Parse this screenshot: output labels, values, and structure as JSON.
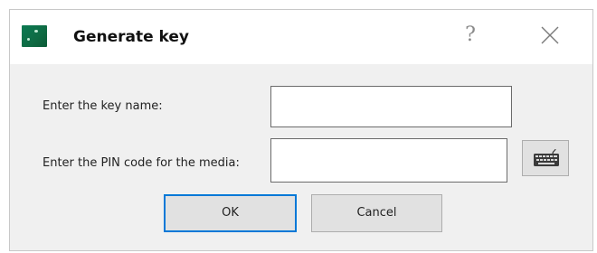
{
  "window": {
    "title": "Generate key",
    "app_icon": "app-logo-icon",
    "help_glyph": "?",
    "help_icon": "question-icon",
    "close_icon": "close-icon"
  },
  "form": {
    "key_name_label": "Enter the key name:",
    "key_name_value": "",
    "pin_label": "Enter the PIN code for the media:",
    "pin_value": "",
    "keyboard_icon": "virtual-keyboard-icon"
  },
  "buttons": {
    "ok_label": "OK",
    "cancel_label": "Cancel"
  },
  "colors": {
    "accent": "#0078d7",
    "dialog_background": "#f0f0f0",
    "titlebar_background": "#ffffff"
  }
}
